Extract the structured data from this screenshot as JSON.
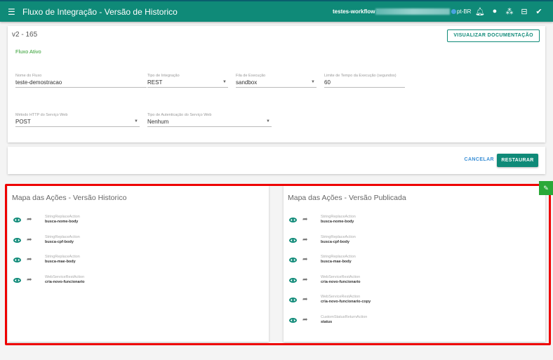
{
  "header": {
    "title": "Fluxo de Integração - Versão de Historico",
    "workspace": "testes-workflow /",
    "language": "pt-BR"
  },
  "version": "v2 - 165",
  "doc_button": "VISUALIZAR DOCUMENTAÇÃO",
  "status": "Fluxo Ativo",
  "fields": {
    "nome": {
      "label": "Nome do Fluxo",
      "value": "teste-demostracao"
    },
    "tipo": {
      "label": "Tipo de Integração",
      "value": "REST"
    },
    "fila": {
      "label": "Fila de Execução",
      "value": "sandbox"
    },
    "limite": {
      "label": "Limite de Tempo da Execução (segundos)",
      "value": "60"
    },
    "metodo": {
      "label": "Método HTTP do Serviço Web",
      "value": "POST"
    },
    "auth": {
      "label": "Tipo de Autenticação do Serviço Web",
      "value": "Nenhum"
    }
  },
  "actions": {
    "cancel": "CANCELAR",
    "restore": "RESTAURAR"
  },
  "historico": {
    "title": "Mapa das Ações - Versão Historico",
    "items": [
      {
        "type": "StringReplaceAction",
        "name": "busca-nome-body"
      },
      {
        "type": "StringReplaceAction",
        "name": "busca-cpf-body"
      },
      {
        "type": "StringReplaceAction",
        "name": "busca-mae-body"
      },
      {
        "type": "WebServiceRestAction",
        "name": "cria-novo-funcionario"
      }
    ]
  },
  "publicada": {
    "title": "Mapa das Ações - Versão Publicada",
    "items": [
      {
        "type": "StringReplaceAction",
        "name": "busca-nome-body"
      },
      {
        "type": "StringReplaceAction",
        "name": "busca-cpf-body"
      },
      {
        "type": "StringReplaceAction",
        "name": "busca-mae-body"
      },
      {
        "type": "WebServiceRestAction",
        "name": "cria-novo-funcionario"
      },
      {
        "type": "WebServiceRestAction",
        "name": "cria-novo-funcionario-copy"
      },
      {
        "type": "CustomStatusReturnAction",
        "name": "status"
      }
    ]
  }
}
